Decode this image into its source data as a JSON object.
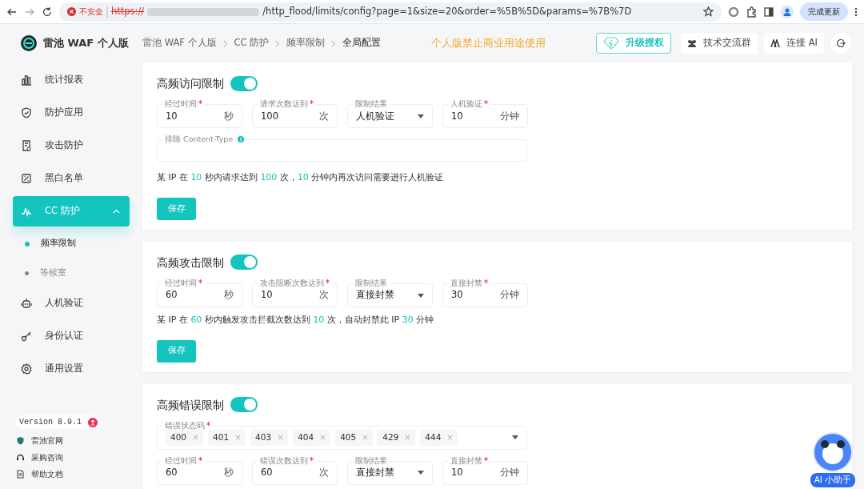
{
  "browser": {
    "security_label": "不安全",
    "url_scheme": "https://",
    "url_path": "/http_flood/limits/config?page=1&size=20&order=%5B%5D&params=%7B%7D",
    "update_button": "完成更新"
  },
  "app": {
    "title": "雷池 WAF 个人版"
  },
  "breadcrumb": [
    {
      "label": "雷池 WAF 个人版",
      "current": false
    },
    {
      "label": "CC 防护",
      "current": false
    },
    {
      "label": "频率限制",
      "current": false
    },
    {
      "label": "全局配置",
      "current": true
    }
  ],
  "notice": "个人版禁止商业用途使用",
  "header_buttons": [
    {
      "kind": "upgrade",
      "label": "升级授权"
    },
    {
      "kind": "group",
      "label": "技术交流群"
    },
    {
      "kind": "ai",
      "label": "连接 AI"
    },
    {
      "kind": "logout"
    }
  ],
  "sidebar": {
    "items": [
      {
        "label": "统计报表",
        "selected": false
      },
      {
        "label": "防护应用",
        "selected": false
      },
      {
        "label": "攻击防护",
        "selected": false
      },
      {
        "label": "黑白名单",
        "selected": false
      },
      {
        "label": "CC 防护",
        "selected": true,
        "expanded": true,
        "children": [
          {
            "label": "频率限制",
            "selected": true
          },
          {
            "label": "等候室",
            "selected": false
          }
        ]
      },
      {
        "label": "人机验证",
        "selected": false
      },
      {
        "label": "身份认证",
        "selected": false
      },
      {
        "label": "通用设置",
        "selected": false
      }
    ]
  },
  "version": {
    "label": "Version 8.9.1",
    "update_available": true
  },
  "footer_links": [
    "雷池官网",
    "采购咨询",
    "帮助文档"
  ],
  "sections": [
    {
      "title": "高频访问限制",
      "enabled": true,
      "blocks": [
        {
          "kind": "fields",
          "fields": [
            {
              "kind": "number",
              "label": "经过时间",
              "required": true,
              "value": "10",
              "unit": "秒"
            },
            {
              "kind": "number",
              "label": "请求次数达到",
              "required": true,
              "value": "100",
              "unit": "次"
            },
            {
              "kind": "select",
              "label": "限制结果",
              "required": false,
              "value": "人机验证"
            },
            {
              "kind": "number",
              "label": "人机验证",
              "required": true,
              "value": "10",
              "unit": "分钟"
            }
          ]
        },
        {
          "kind": "wide",
          "label": "排除 Content-Type",
          "info": true
        },
        {
          "kind": "summary",
          "parts": [
            {
              "text": "某 IP 在 ",
              "highlight": false
            },
            {
              "text": "10",
              "highlight": true
            },
            {
              "text": " 秒内请求达到 ",
              "highlight": false
            },
            {
              "text": "100",
              "highlight": true
            },
            {
              "text": " 次，",
              "highlight": false
            },
            {
              "text": "10",
              "highlight": true
            },
            {
              "text": " 分钟内再次访问需要进行人机验证",
              "highlight": false
            }
          ]
        },
        {
          "kind": "button",
          "label": "保存"
        }
      ]
    },
    {
      "title": "高频攻击限制",
      "enabled": true,
      "blocks": [
        {
          "kind": "fields",
          "fields": [
            {
              "kind": "number",
              "label": "经过时间",
              "required": true,
              "value": "60",
              "unit": "秒"
            },
            {
              "kind": "number",
              "label": "攻击阻断次数达到",
              "required": true,
              "value": "10",
              "unit": "次"
            },
            {
              "kind": "select",
              "label": "限制结果",
              "required": false,
              "value": "直接封禁"
            },
            {
              "kind": "number",
              "label": "直接封禁",
              "required": true,
              "value": "30",
              "unit": "分钟"
            }
          ]
        },
        {
          "kind": "summary",
          "parts": [
            {
              "text": "某 IP 在 ",
              "highlight": false
            },
            {
              "text": "60",
              "highlight": true
            },
            {
              "text": " 秒内触发攻击拦截次数达到 ",
              "highlight": false
            },
            {
              "text": "10",
              "highlight": true
            },
            {
              "text": " 次，自动封禁此 IP ",
              "highlight": false
            },
            {
              "text": "30",
              "highlight": true
            },
            {
              "text": " 分钟",
              "highlight": false
            }
          ]
        },
        {
          "kind": "button",
          "label": "保存"
        }
      ]
    },
    {
      "title": "高频错误限制",
      "enabled": true,
      "blocks": [
        {
          "kind": "tags",
          "label": "错误状态码",
          "required": true,
          "tags": [
            "400",
            "401",
            "403",
            "404",
            "405",
            "429",
            "444"
          ]
        },
        {
          "kind": "fields",
          "fields": [
            {
              "kind": "number",
              "label": "经过时间",
              "required": true,
              "value": "60",
              "unit": "秒"
            },
            {
              "kind": "number",
              "label": "错误次数达到",
              "required": true,
              "value": "60",
              "unit": "次"
            },
            {
              "kind": "select",
              "label": "限制结果",
              "required": false,
              "value": "直接封禁"
            },
            {
              "kind": "number",
              "label": "直接封禁",
              "required": true,
              "value": "10",
              "unit": "分钟"
            }
          ]
        }
      ]
    }
  ],
  "assistant": {
    "label": "AI 小助手"
  }
}
